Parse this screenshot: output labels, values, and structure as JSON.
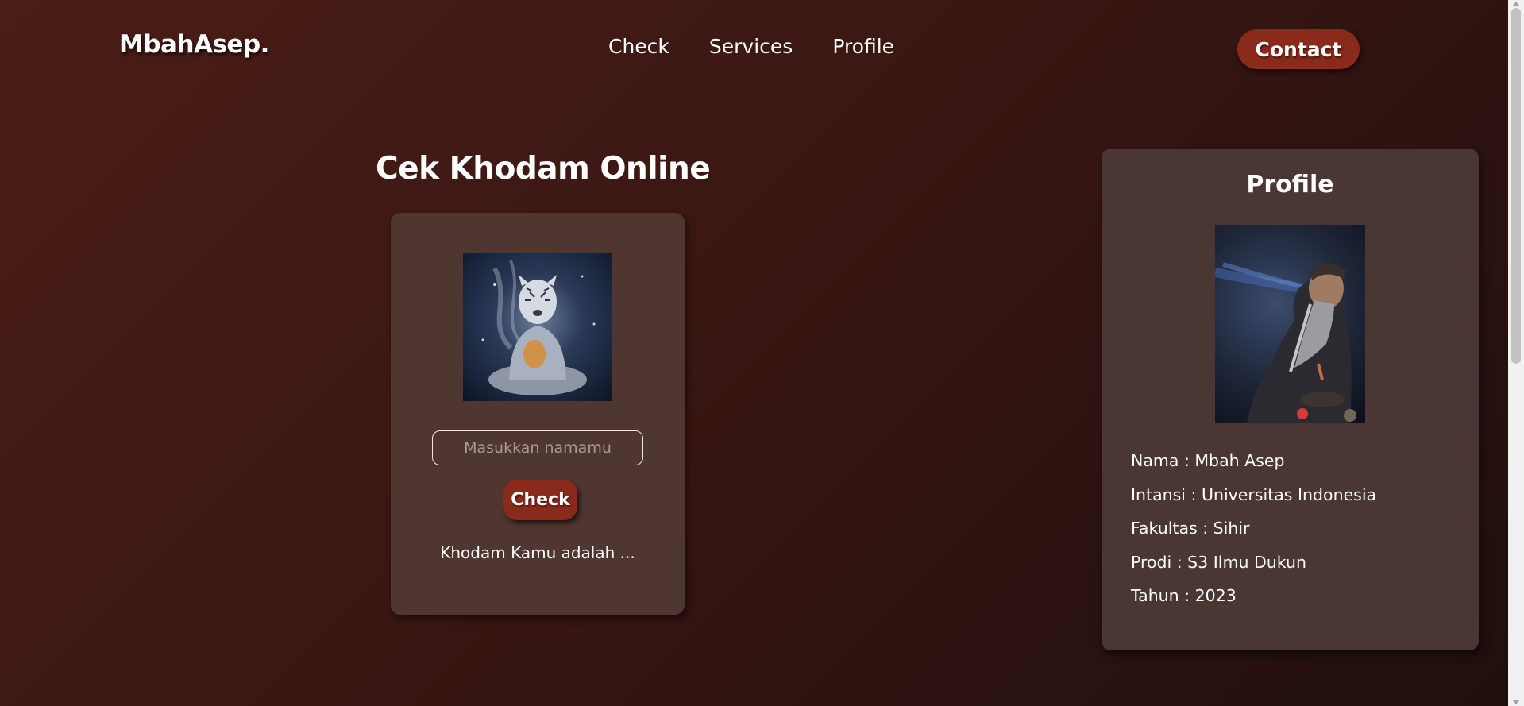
{
  "navbar": {
    "logo": "MbahAsep.",
    "links": [
      {
        "label": "Check"
      },
      {
        "label": "Services"
      },
      {
        "label": "Profile"
      }
    ],
    "contact_label": "Contact"
  },
  "main": {
    "title": "Cek Khodam Online",
    "check_card": {
      "image_icon": "meditating-tiger-spirit-image",
      "input_placeholder": "Masukkan namamu",
      "input_value": "",
      "button_label": "Check",
      "result_text": "Khodam Kamu adalah ..."
    }
  },
  "profile": {
    "title": "Profile",
    "image_icon": "old-man-portrait-image",
    "details": [
      {
        "text": "Nama : Mbah Asep"
      },
      {
        "text": "Intansi : Universitas Indonesia"
      },
      {
        "text": "Fakultas : Sihir"
      },
      {
        "text": "Prodi : S3 Ilmu Dukun"
      },
      {
        "text": "Tahun : 2023"
      }
    ]
  },
  "colors": {
    "accent_button": "#8a2a1b",
    "card_background": "#4f3631",
    "page_background": "#3a1713"
  }
}
